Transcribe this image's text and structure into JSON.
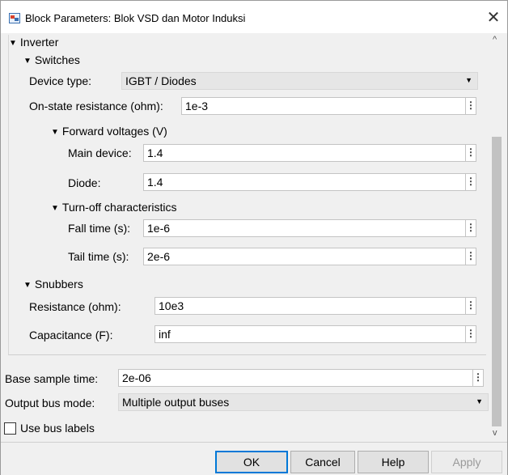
{
  "window": {
    "title": "Block Parameters: Blok VSD dan Motor Induksi",
    "close_glyph": "✕"
  },
  "sections": {
    "inverter": "Inverter",
    "switches": "Switches",
    "forward": "Forward voltages (V)",
    "turnoff": "Turn-off characteristics",
    "snubbers": "Snubbers"
  },
  "fields": {
    "device_type": {
      "label": "Device type:",
      "value": "IGBT / Diodes"
    },
    "on_state": {
      "label": "On-state resistance (ohm):",
      "value": "1e-3"
    },
    "main_device": {
      "label": "Main device:",
      "value": "1.4"
    },
    "diode": {
      "label": "Diode:",
      "value": "1.4"
    },
    "fall_time": {
      "label": "Fall time (s):",
      "value": "1e-6"
    },
    "tail_time": {
      "label": "Tail time (s):",
      "value": "2e-6"
    },
    "resistance": {
      "label": "Resistance (ohm):",
      "value": "10e3"
    },
    "capacitance": {
      "label": "Capacitance (F):",
      "value": "inf"
    },
    "base_sample": {
      "label": "Base sample time:",
      "value": "2e-06"
    },
    "output_bus": {
      "label": "Output bus mode:",
      "value": "Multiple output buses"
    },
    "use_bus_labels": {
      "label": "Use bus labels",
      "checked": false
    }
  },
  "buttons": {
    "ok": "OK",
    "cancel": "Cancel",
    "help": "Help",
    "apply": "Apply"
  },
  "icons": {
    "more": "⋮",
    "triangle": "▼",
    "dropdown": "▼",
    "scroll_up": "^",
    "scroll_down": "v"
  }
}
